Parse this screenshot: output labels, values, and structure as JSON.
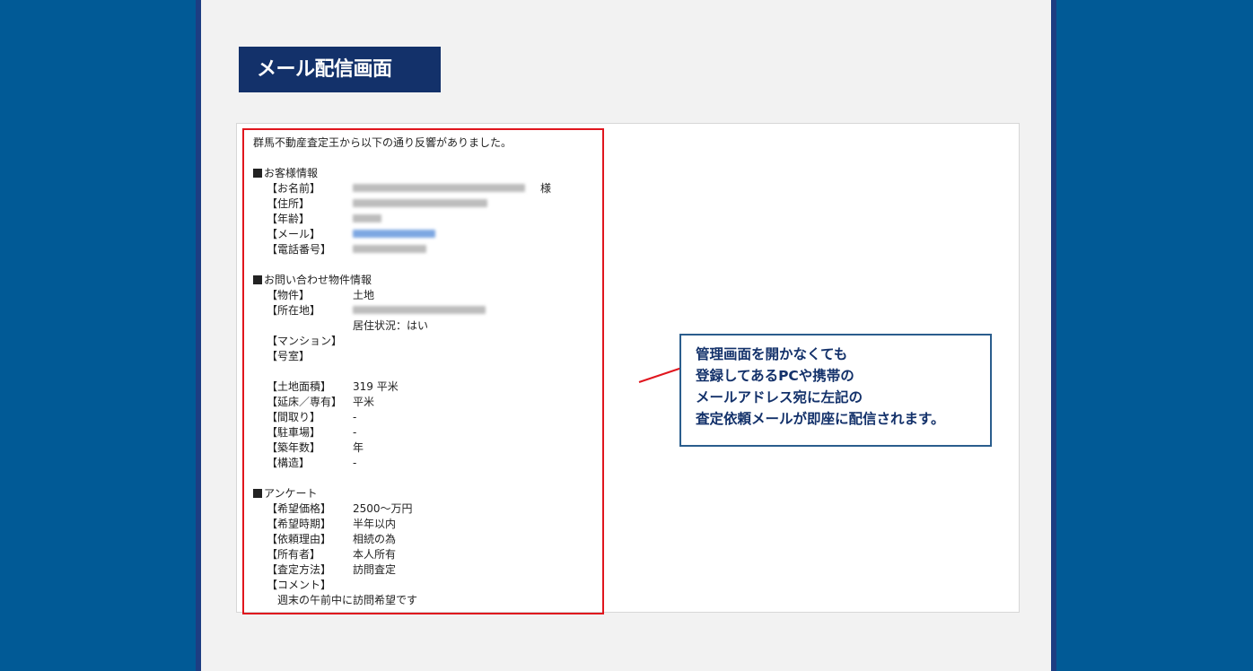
{
  "heading": "メール配信画面",
  "mail": {
    "intro": "群馬不動産査定王から以下の通り反響がありました。",
    "customer_section": "お客様情報",
    "customer": [
      {
        "label": "【お名前】",
        "blurred": true,
        "blur_width": 192,
        "suffix": "様"
      },
      {
        "label": "【住所】",
        "blurred": true,
        "blur_width": 150
      },
      {
        "label": "【年齢】",
        "blurred": true,
        "blur_width": 32
      },
      {
        "label": "【メール】",
        "blurred": true,
        "blur_width": 92,
        "link": true
      },
      {
        "label": "【電話番号】",
        "blurred": true,
        "blur_width": 82
      }
    ],
    "property_section": "お問い合わせ物件情報",
    "property_type_label": "【物件】",
    "property_type_value": "土地",
    "location_label": "【所在地】",
    "residence_status": "居住状況：はい",
    "mansion_label": "【マンション】",
    "room_label": "【号室】",
    "specs": [
      {
        "label": "【土地面積】",
        "value": "319 平米"
      },
      {
        "label": "【延床／専有】",
        "value": "平米"
      },
      {
        "label": "【間取り】",
        "value": "-"
      },
      {
        "label": "【駐車場】",
        "value": "-"
      },
      {
        "label": "【築年数】",
        "value": "年"
      },
      {
        "label": "【構造】",
        "value": "-"
      }
    ],
    "survey_section": "アンケート",
    "survey": [
      {
        "label": "【希望価格】",
        "value": "2500～万円"
      },
      {
        "label": "【希望時期】",
        "value": "半年以内"
      },
      {
        "label": "【依頼理由】",
        "value": "相続の為"
      },
      {
        "label": "【所有者】",
        "value": "本人所有"
      },
      {
        "label": "【査定方法】",
        "value": "訪問査定"
      }
    ],
    "comment_label": "【コメント】",
    "comment_text": "週末の午前中に訪問希望です"
  },
  "callout": {
    "lines": [
      "管理画面を開かなくても",
      "登録してあるPCや携帯の",
      "メールアドレス宛に左記の",
      "査定依頼メールが即座に配信されます。"
    ]
  }
}
